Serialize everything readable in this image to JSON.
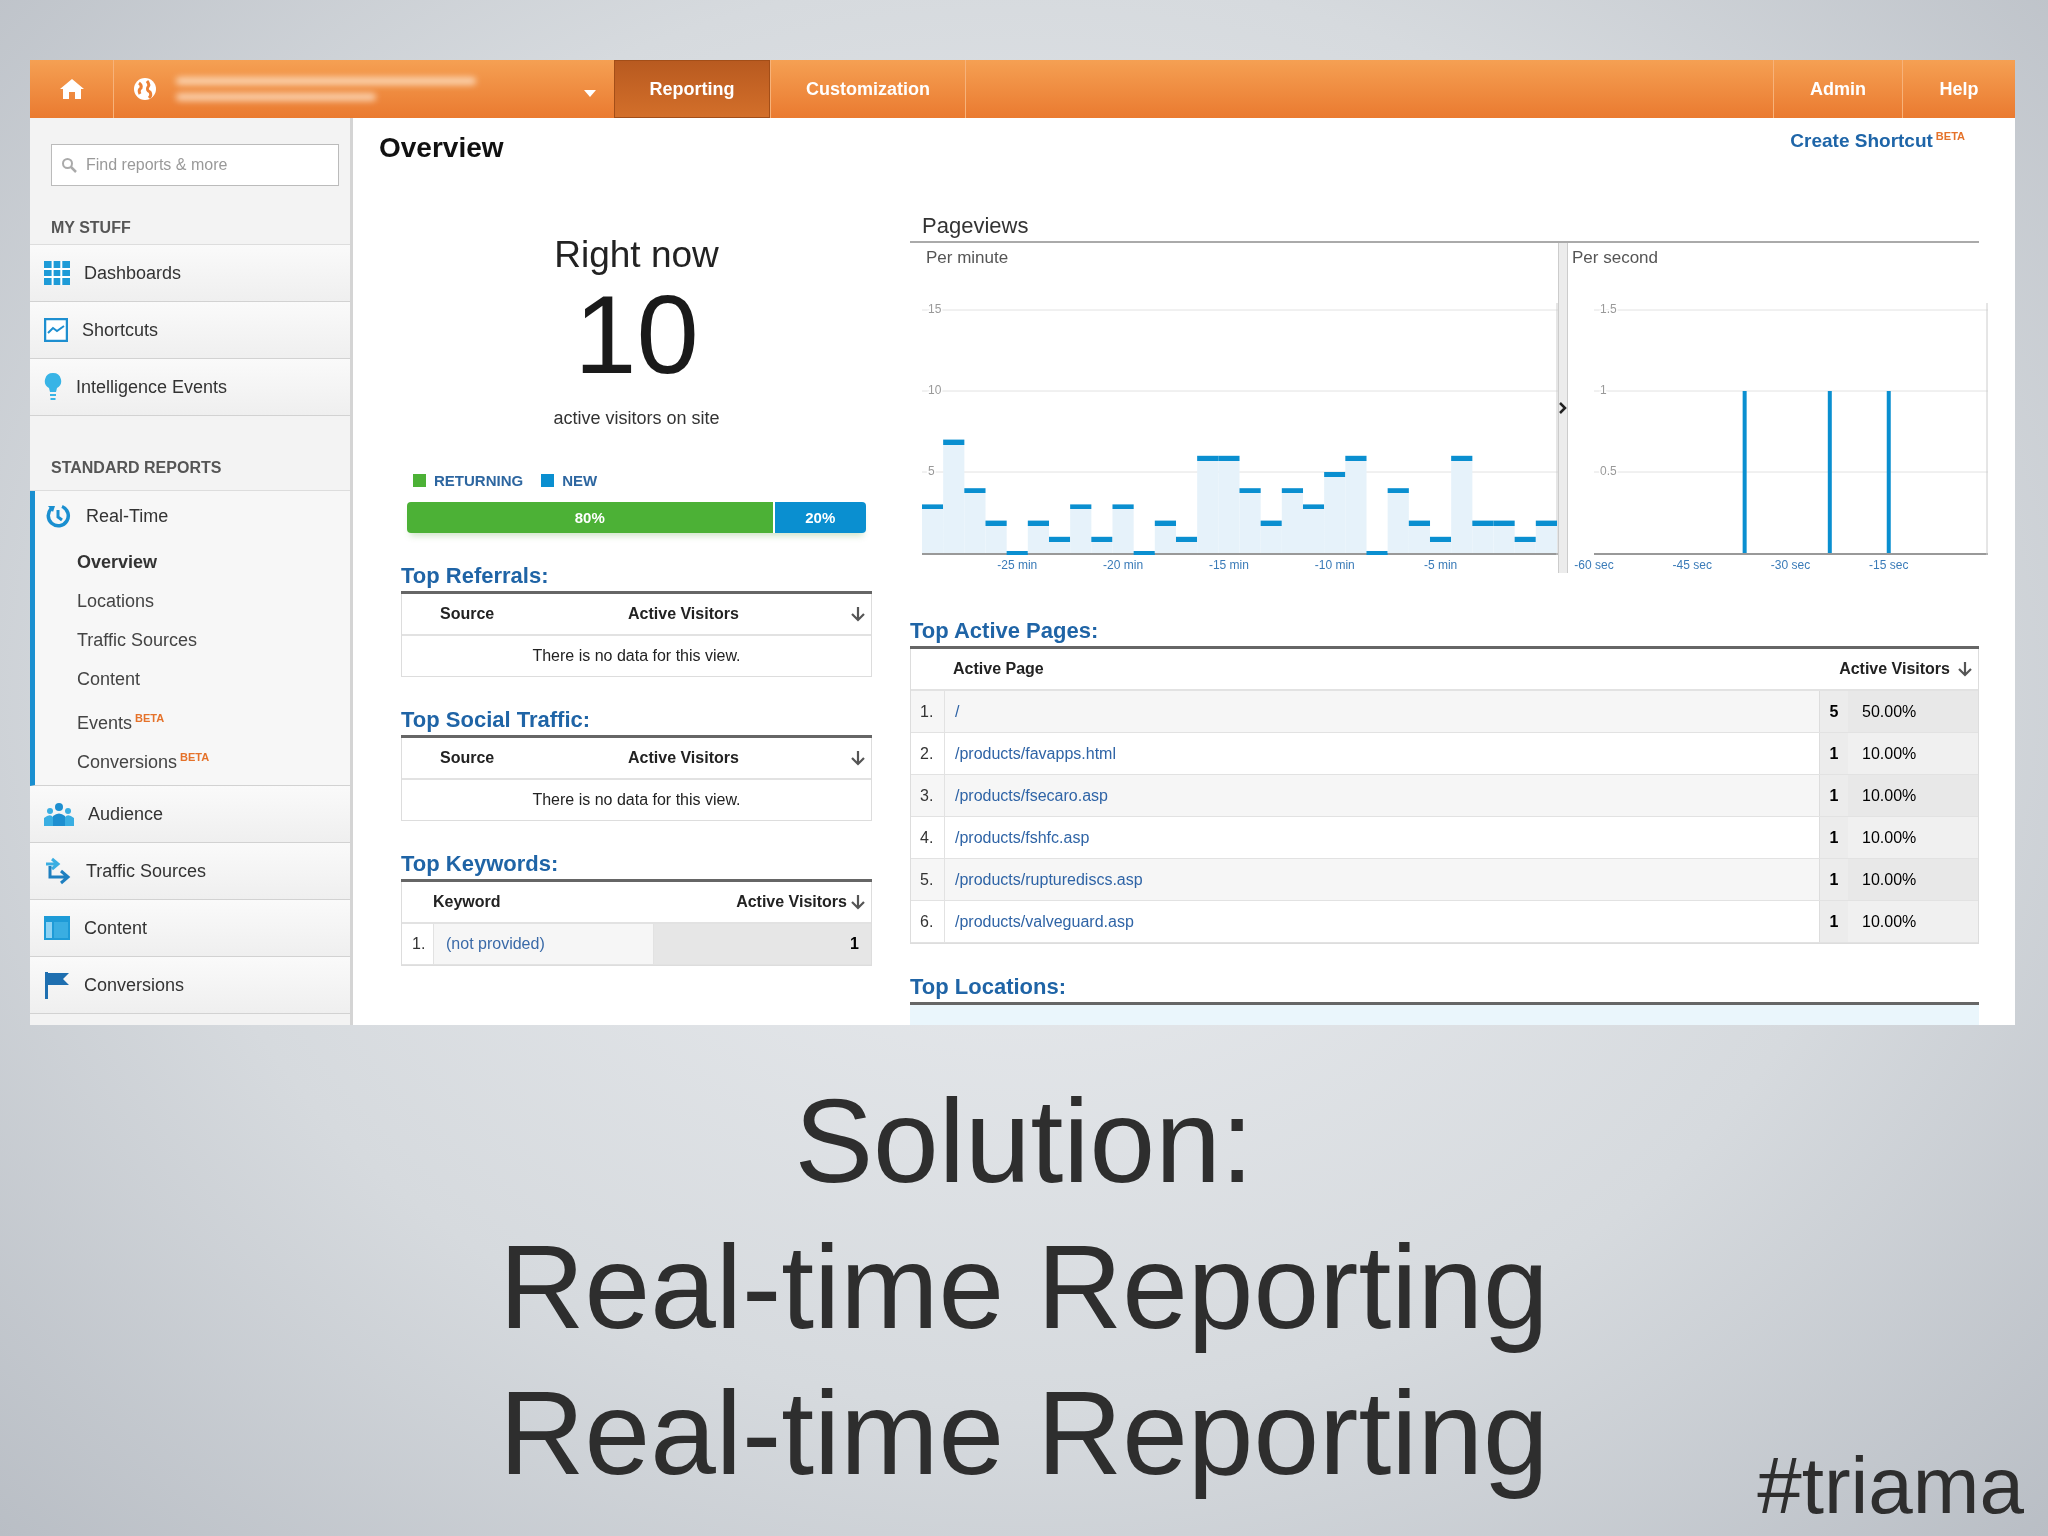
{
  "header": {
    "tabs": [
      {
        "label": "Reporting",
        "selected": true
      },
      {
        "label": "Customization",
        "selected": false
      }
    ],
    "links": [
      "Admin",
      "Help"
    ]
  },
  "sidebar": {
    "search": {
      "placeholder": "Find reports & more"
    },
    "my_stuff": {
      "heading": "MY STUFF",
      "items": [
        "Dashboards",
        "Shortcuts",
        "Intelligence Events"
      ]
    },
    "standard_reports": {
      "heading": "STANDARD REPORTS",
      "items": [
        {
          "label": "Real-Time",
          "expanded": true,
          "children": [
            {
              "label": "Overview",
              "selected": true
            },
            {
              "label": "Locations",
              "selected": false
            },
            {
              "label": "Traffic Sources",
              "selected": false
            },
            {
              "label": "Content",
              "selected": false
            },
            {
              "label": "Events",
              "selected": false,
              "badge": "BETA"
            },
            {
              "label": "Conversions",
              "selected": false,
              "badge": "BETA"
            }
          ]
        },
        {
          "label": "Audience",
          "expanded": false
        },
        {
          "label": "Traffic Sources",
          "expanded": false
        },
        {
          "label": "Content",
          "expanded": false
        },
        {
          "label": "Conversions",
          "expanded": false
        }
      ]
    }
  },
  "page": {
    "title": "Overview",
    "shortcut": {
      "label": "Create Shortcut",
      "badge": "BETA"
    },
    "right_now": {
      "heading": "Right now",
      "count": "10",
      "caption": "active visitors on site",
      "segments": [
        {
          "legend": "RETURNING",
          "label": "80%",
          "level": 0.8,
          "color": "#4cb136"
        },
        {
          "legend": "NEW",
          "label": "20%",
          "level": 0.2,
          "color": "#0a8fd0"
        }
      ]
    },
    "pageviews": {
      "title": "Pageviews",
      "panels": [
        {
          "title": "Per minute",
          "chart_data": {
            "type": "bar",
            "x": [
              -29.5,
              -28.5,
              -27.5,
              -26.5,
              -25.5,
              -24.5,
              -23.5,
              -22.5,
              -21.5,
              -20.5,
              -19.5,
              -18.5,
              -17.5,
              -16.5,
              -15.5,
              -14.5,
              -13.5,
              -12.5,
              -11.5,
              -10.5,
              -9.5,
              -8.5,
              -7.5,
              -6.5,
              -5.5,
              -4.5,
              -3.5,
              -2.5,
              -1.5,
              -0.5
            ],
            "values": [
              3,
              7,
              4,
              2,
              0,
              2,
              1,
              3,
              1,
              3,
              0,
              2,
              1,
              6,
              6,
              4,
              2,
              4,
              3,
              5,
              6,
              0,
              4,
              2,
              1,
              6,
              2,
              2,
              1,
              2
            ],
            "xlim": [
              -30,
              0
            ],
            "ylim": [
              0,
              15
            ],
            "yticks": [
              5,
              10,
              15
            ],
            "xticks": [
              {
                "value": -25.5,
                "label": "-25 min"
              },
              {
                "value": -20.5,
                "label": "-20 min"
              },
              {
                "value": -15.5,
                "label": "-15 min"
              },
              {
                "value": -10.5,
                "label": "-10 min"
              },
              {
                "value": -5.5,
                "label": "-5 min"
              }
            ]
          }
        },
        {
          "title": "Per second",
          "chart_data": {
            "type": "bar",
            "x": [
              -37,
              -24,
              -15
            ],
            "values": [
              1,
              1,
              1
            ],
            "xlim": [
              -60,
              0
            ],
            "ylim": [
              0,
              1.5
            ],
            "yticks": [
              0.5,
              1,
              1.5
            ],
            "xticks": [
              {
                "value": -60,
                "label": "-60 sec"
              },
              {
                "value": -45,
                "label": "-45 sec"
              },
              {
                "value": -30,
                "label": "-30 sec"
              },
              {
                "value": -15,
                "label": "-15 sec"
              }
            ]
          }
        }
      ]
    },
    "left_tables": [
      {
        "title": "Top Referrals:",
        "columns": [
          "Source",
          "Active Visitors"
        ],
        "empty_message": "There is no data for this view."
      },
      {
        "title": "Top Social Traffic:",
        "columns": [
          "Source",
          "Active Visitors"
        ],
        "empty_message": "There is no data for this view."
      },
      {
        "title": "Top Keywords:",
        "columns": [
          "Keyword",
          "Active Visitors"
        ],
        "rows": [
          {
            "index": "1.",
            "keyword": "(not provided)",
            "visitors": "1"
          }
        ]
      }
    ],
    "active_pages": {
      "title": "Top Active Pages:",
      "columns": [
        "Active Page",
        "Active Visitors"
      ],
      "rows": [
        {
          "index": "1.",
          "page": "/",
          "visitors": "5",
          "share": "50.00%"
        },
        {
          "index": "2.",
          "page": "/products/favapps.html",
          "visitors": "1",
          "share": "10.00%"
        },
        {
          "index": "3.",
          "page": "/products/fsecaro.asp",
          "visitors": "1",
          "share": "10.00%"
        },
        {
          "index": "4.",
          "page": "/products/fshfc.asp",
          "visitors": "1",
          "share": "10.00%"
        },
        {
          "index": "5.",
          "page": "/products/rupturediscs.asp",
          "visitors": "1",
          "share": "10.00%"
        },
        {
          "index": "6.",
          "page": "/products/valveguard.asp",
          "visitors": "1",
          "share": "10.00%"
        }
      ]
    },
    "locations": {
      "title": "Top Locations:"
    }
  },
  "caption": [
    "Solution:",
    "Real-time Reporting",
    "Real-time Reporting"
  ],
  "hashtag": "#triama"
}
